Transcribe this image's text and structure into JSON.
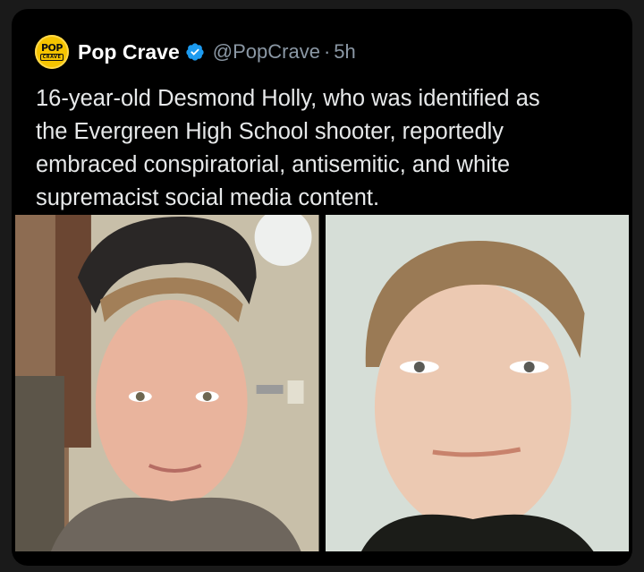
{
  "tweet": {
    "author_name": "Pop Crave",
    "handle": "@PopCrave",
    "separator": "·",
    "time": "5h",
    "avatar": {
      "line1": "POP",
      "line2": "CRAVE"
    },
    "text": "16-year-old Desmond Holly, who was identified as\nthe Evergreen High School shooter, reportedly\nembraced conspiratorial, antisemitic, and white\nsupremacist social media content.",
    "verified_icon": "verified-badge-icon"
  },
  "media": [
    {
      "description_icon": "photo",
      "kind": "selfie-photo"
    },
    {
      "description_icon": "photo",
      "kind": "id-photo"
    }
  ],
  "colors": {
    "background": "#000000",
    "text": "#e7e9ea",
    "muted": "#8b98a5",
    "verified": "#1d9bf0",
    "avatar": "#f6c400"
  }
}
